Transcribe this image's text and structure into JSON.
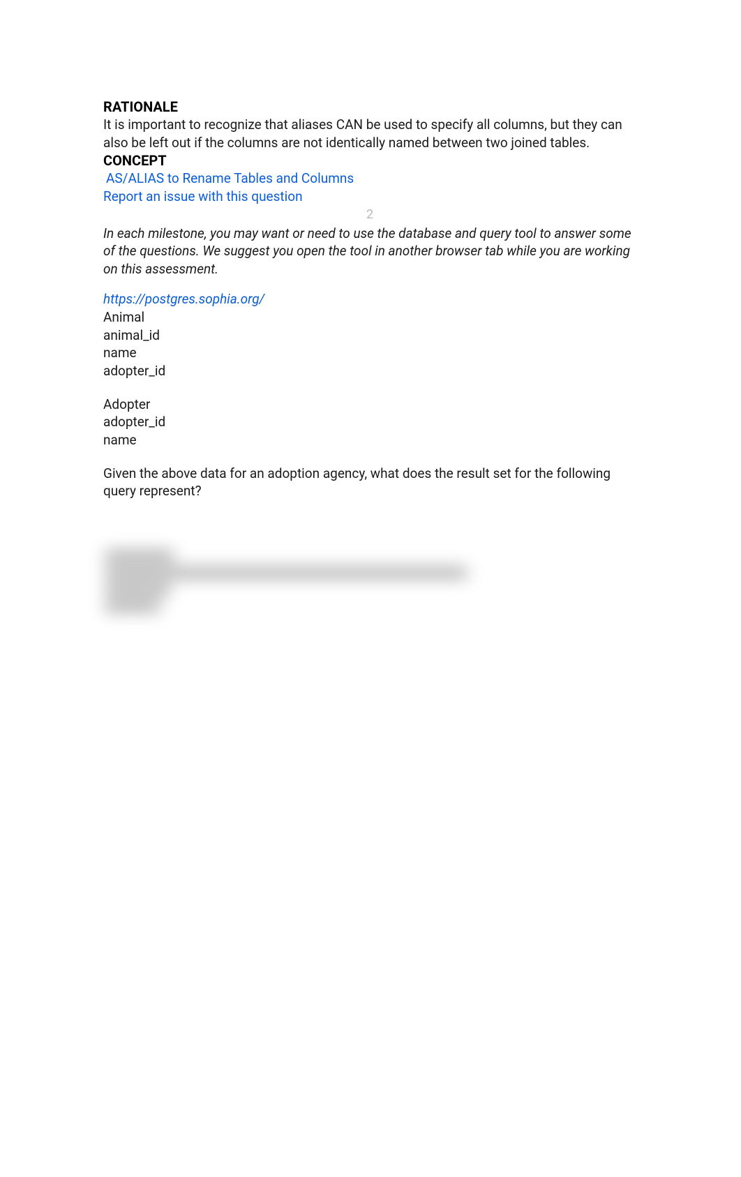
{
  "rationale": {
    "heading": "RATIONALE",
    "text": "It is important to recognize that aliases CAN be used to specify all columns, but they can also be left out if the columns are not identically named between two joined tables."
  },
  "concept": {
    "heading": "CONCEPT",
    "link": " AS/ALIAS to Rename Tables and Columns"
  },
  "reportLink": "Report an issue with this question",
  "questionNumber": "2",
  "instructions": "In each milestone, you may want or need to use the database and query tool to answer some of the questions. We suggest you open the tool in another browser tab while you are working on this assessment.",
  "toolUrl": "https://postgres.sophia.org/",
  "schema": {
    "table1": {
      "name": "Animal",
      "cols": [
        "animal_id",
        "name",
        "adopter_id"
      ]
    },
    "table2": {
      "name": "Adopter",
      "cols": [
        "adopter_id",
        "name"
      ]
    }
  },
  "questionText": "Given the above data for an adoption agency, what does the result set for the following query represent?"
}
